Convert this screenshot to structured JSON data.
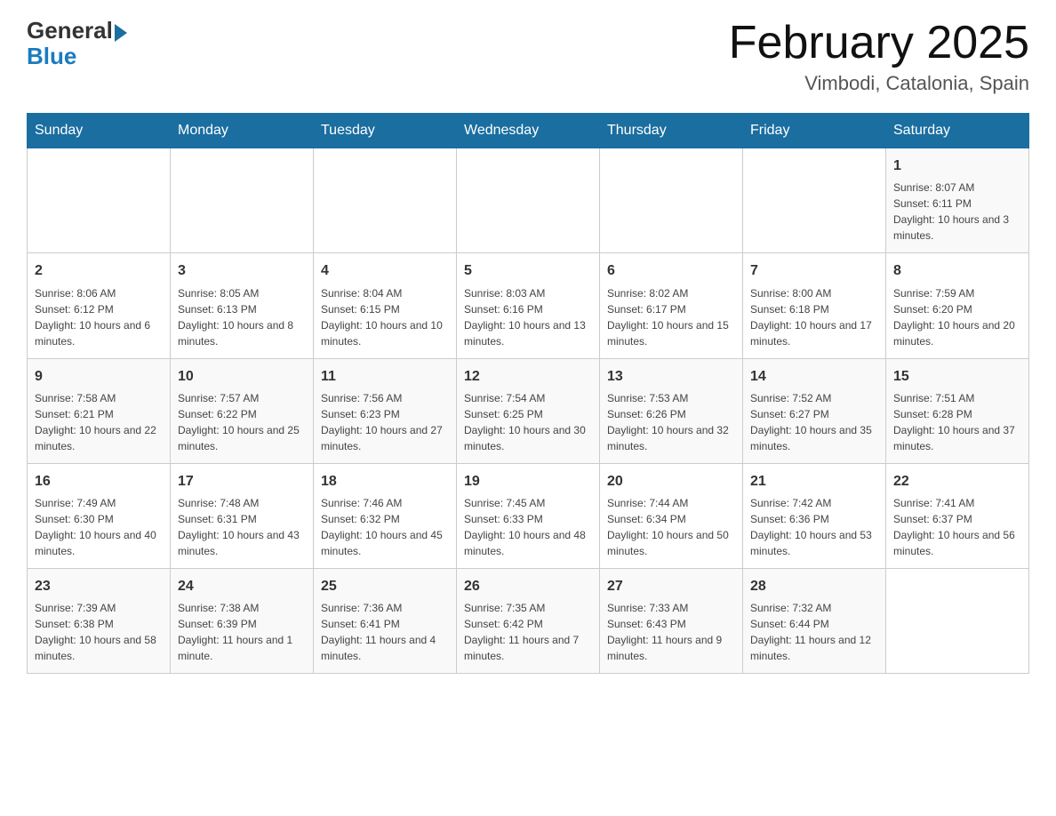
{
  "header": {
    "logo_general": "General",
    "logo_blue": "Blue",
    "month_year": "February 2025",
    "location": "Vimbodi, Catalonia, Spain"
  },
  "weekdays": [
    "Sunday",
    "Monday",
    "Tuesday",
    "Wednesday",
    "Thursday",
    "Friday",
    "Saturday"
  ],
  "weeks": [
    [
      {
        "day": "",
        "info": ""
      },
      {
        "day": "",
        "info": ""
      },
      {
        "day": "",
        "info": ""
      },
      {
        "day": "",
        "info": ""
      },
      {
        "day": "",
        "info": ""
      },
      {
        "day": "",
        "info": ""
      },
      {
        "day": "1",
        "info": "Sunrise: 8:07 AM\nSunset: 6:11 PM\nDaylight: 10 hours and 3 minutes."
      }
    ],
    [
      {
        "day": "2",
        "info": "Sunrise: 8:06 AM\nSunset: 6:12 PM\nDaylight: 10 hours and 6 minutes."
      },
      {
        "day": "3",
        "info": "Sunrise: 8:05 AM\nSunset: 6:13 PM\nDaylight: 10 hours and 8 minutes."
      },
      {
        "day": "4",
        "info": "Sunrise: 8:04 AM\nSunset: 6:15 PM\nDaylight: 10 hours and 10 minutes."
      },
      {
        "day": "5",
        "info": "Sunrise: 8:03 AM\nSunset: 6:16 PM\nDaylight: 10 hours and 13 minutes."
      },
      {
        "day": "6",
        "info": "Sunrise: 8:02 AM\nSunset: 6:17 PM\nDaylight: 10 hours and 15 minutes."
      },
      {
        "day": "7",
        "info": "Sunrise: 8:00 AM\nSunset: 6:18 PM\nDaylight: 10 hours and 17 minutes."
      },
      {
        "day": "8",
        "info": "Sunrise: 7:59 AM\nSunset: 6:20 PM\nDaylight: 10 hours and 20 minutes."
      }
    ],
    [
      {
        "day": "9",
        "info": "Sunrise: 7:58 AM\nSunset: 6:21 PM\nDaylight: 10 hours and 22 minutes."
      },
      {
        "day": "10",
        "info": "Sunrise: 7:57 AM\nSunset: 6:22 PM\nDaylight: 10 hours and 25 minutes."
      },
      {
        "day": "11",
        "info": "Sunrise: 7:56 AM\nSunset: 6:23 PM\nDaylight: 10 hours and 27 minutes."
      },
      {
        "day": "12",
        "info": "Sunrise: 7:54 AM\nSunset: 6:25 PM\nDaylight: 10 hours and 30 minutes."
      },
      {
        "day": "13",
        "info": "Sunrise: 7:53 AM\nSunset: 6:26 PM\nDaylight: 10 hours and 32 minutes."
      },
      {
        "day": "14",
        "info": "Sunrise: 7:52 AM\nSunset: 6:27 PM\nDaylight: 10 hours and 35 minutes."
      },
      {
        "day": "15",
        "info": "Sunrise: 7:51 AM\nSunset: 6:28 PM\nDaylight: 10 hours and 37 minutes."
      }
    ],
    [
      {
        "day": "16",
        "info": "Sunrise: 7:49 AM\nSunset: 6:30 PM\nDaylight: 10 hours and 40 minutes."
      },
      {
        "day": "17",
        "info": "Sunrise: 7:48 AM\nSunset: 6:31 PM\nDaylight: 10 hours and 43 minutes."
      },
      {
        "day": "18",
        "info": "Sunrise: 7:46 AM\nSunset: 6:32 PM\nDaylight: 10 hours and 45 minutes."
      },
      {
        "day": "19",
        "info": "Sunrise: 7:45 AM\nSunset: 6:33 PM\nDaylight: 10 hours and 48 minutes."
      },
      {
        "day": "20",
        "info": "Sunrise: 7:44 AM\nSunset: 6:34 PM\nDaylight: 10 hours and 50 minutes."
      },
      {
        "day": "21",
        "info": "Sunrise: 7:42 AM\nSunset: 6:36 PM\nDaylight: 10 hours and 53 minutes."
      },
      {
        "day": "22",
        "info": "Sunrise: 7:41 AM\nSunset: 6:37 PM\nDaylight: 10 hours and 56 minutes."
      }
    ],
    [
      {
        "day": "23",
        "info": "Sunrise: 7:39 AM\nSunset: 6:38 PM\nDaylight: 10 hours and 58 minutes."
      },
      {
        "day": "24",
        "info": "Sunrise: 7:38 AM\nSunset: 6:39 PM\nDaylight: 11 hours and 1 minute."
      },
      {
        "day": "25",
        "info": "Sunrise: 7:36 AM\nSunset: 6:41 PM\nDaylight: 11 hours and 4 minutes."
      },
      {
        "day": "26",
        "info": "Sunrise: 7:35 AM\nSunset: 6:42 PM\nDaylight: 11 hours and 7 minutes."
      },
      {
        "day": "27",
        "info": "Sunrise: 7:33 AM\nSunset: 6:43 PM\nDaylight: 11 hours and 9 minutes."
      },
      {
        "day": "28",
        "info": "Sunrise: 7:32 AM\nSunset: 6:44 PM\nDaylight: 11 hours and 12 minutes."
      },
      {
        "day": "",
        "info": ""
      }
    ]
  ]
}
